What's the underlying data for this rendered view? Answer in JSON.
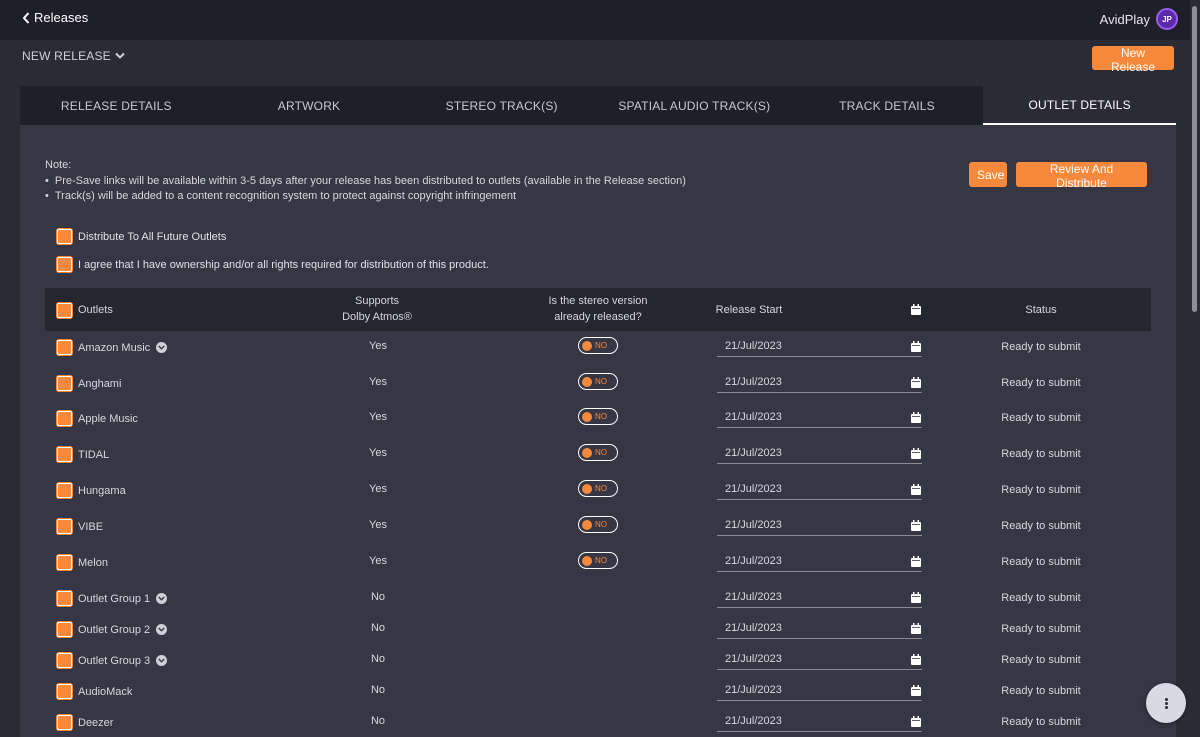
{
  "topbar": {
    "back_label": "Releases",
    "brand": "AvidPlay",
    "brand_logo_text": "JP"
  },
  "subheader": {
    "menu_label": "NEW RELEASE",
    "new_release_button": "New Release"
  },
  "tabs": [
    {
      "label": "RELEASE DETAILS",
      "active": false
    },
    {
      "label": "ARTWORK",
      "active": false
    },
    {
      "label": "STEREO TRACK(S)",
      "active": false
    },
    {
      "label": "SPATIAL AUDIO TRACK(S)",
      "active": false
    },
    {
      "label": "TRACK DETAILS",
      "active": false
    },
    {
      "label": "OUTLET DETAILS",
      "active": true
    }
  ],
  "note": {
    "title": "Note:",
    "items": [
      "Pre-Save links will be available within 3-5 days after your release has been distributed to outlets (available in the Release section)",
      "Track(s) will be added to a content recognition system to protect against copyright infringement"
    ]
  },
  "actions": {
    "save": "Save",
    "review": "Review And Distribute"
  },
  "options": {
    "future_outlets": "Distribute To All Future Outlets",
    "agreement": "I agree that I have ownership and/or all rights required for distribution of this product."
  },
  "table": {
    "headers": {
      "outlets": "Outlets",
      "atmos_line1": "Supports",
      "atmos_line2": "Dolby Atmos®",
      "stereo_line1": "Is the stereo version",
      "stereo_line2": "already released?",
      "release_start": "Release Start",
      "status": "Status"
    },
    "rows": [
      {
        "name": "Amazon Music",
        "expand": true,
        "atmos": "Yes",
        "toggle": "NO",
        "date": "21/Jul/2023",
        "status": "Ready to submit"
      },
      {
        "name": "Anghami",
        "expand": false,
        "atmos": "Yes",
        "toggle": "NO",
        "date": "21/Jul/2023",
        "status": "Ready to submit"
      },
      {
        "name": "Apple Music",
        "expand": false,
        "atmos": "Yes",
        "toggle": "NO",
        "date": "21/Jul/2023",
        "status": "Ready to submit"
      },
      {
        "name": "TIDAL",
        "expand": false,
        "atmos": "Yes",
        "toggle": "NO",
        "date": "21/Jul/2023",
        "status": "Ready to submit"
      },
      {
        "name": "Hungama",
        "expand": false,
        "atmos": "Yes",
        "toggle": "NO",
        "date": "21/Jul/2023",
        "status": "Ready to submit"
      },
      {
        "name": "VIBE",
        "expand": false,
        "atmos": "Yes",
        "toggle": "NO",
        "date": "21/Jul/2023",
        "status": "Ready to submit"
      },
      {
        "name": "Melon",
        "expand": false,
        "atmos": "Yes",
        "toggle": "NO",
        "date": "21/Jul/2023",
        "status": "Ready to submit"
      },
      {
        "name": "Outlet Group 1",
        "expand": true,
        "atmos": "No",
        "toggle": null,
        "date": "21/Jul/2023",
        "status": "Ready to submit"
      },
      {
        "name": "Outlet Group 2",
        "expand": true,
        "atmos": "No",
        "toggle": null,
        "date": "21/Jul/2023",
        "status": "Ready to submit"
      },
      {
        "name": "Outlet Group 3",
        "expand": true,
        "atmos": "No",
        "toggle": null,
        "date": "21/Jul/2023",
        "status": "Ready to submit"
      },
      {
        "name": "AudioMack",
        "expand": false,
        "atmos": "No",
        "toggle": null,
        "date": "21/Jul/2023",
        "status": "Ready to submit"
      },
      {
        "name": "Deezer",
        "expand": false,
        "atmos": "No",
        "toggle": null,
        "date": "21/Jul/2023",
        "status": "Ready to submit"
      }
    ]
  },
  "colors": {
    "accent": "#f7893c",
    "background": "#2b2b36",
    "topbar": "#1f1f29",
    "panel": "#363644"
  },
  "icons": {
    "back": "chevron-left-icon",
    "menu": "chevron-down-icon",
    "calendar": "calendar-icon",
    "fab": "more-vertical-icon"
  }
}
